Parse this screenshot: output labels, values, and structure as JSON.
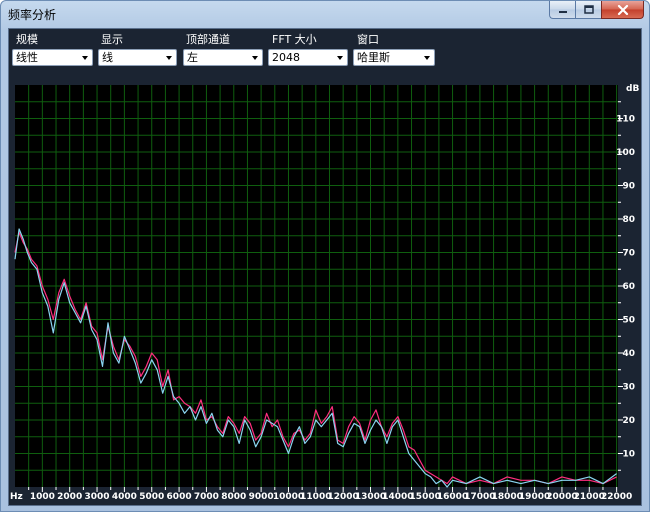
{
  "window": {
    "title": "频率分析",
    "minimize_icon": "minimize-icon",
    "maximize_icon": "maximize-icon",
    "close_icon": "close-icon"
  },
  "controls": [
    {
      "id": "scale",
      "label": "规模",
      "value": "线性"
    },
    {
      "id": "display",
      "label": "显示",
      "value": "线"
    },
    {
      "id": "top-channel",
      "label": "顶部通道",
      "value": "左"
    },
    {
      "id": "fft-size",
      "label": "FFT 大小",
      "value": "2048"
    },
    {
      "id": "window",
      "label": "窗口",
      "value": "哈里斯"
    }
  ],
  "colors": {
    "plot_background": "#000000",
    "grid": "#0f5e0f",
    "left_channel": "#ff2e7e",
    "right_channel": "#8ad4f0",
    "axis_text": "#ffffff"
  },
  "chart_data": {
    "type": "line",
    "x_unit": "Hz",
    "y_unit": "dB",
    "xlim": [
      0,
      22050
    ],
    "ylim": [
      0,
      120
    ],
    "x_ticks": [
      "1000",
      "2000",
      "3000",
      "4000",
      "5000",
      "6000",
      "7000",
      "8000",
      "9000",
      "10000",
      "11000",
      "12000",
      "13000",
      "14000",
      "15000",
      "16000",
      "17000",
      "18000",
      "19000",
      "20000",
      "21000",
      "22000"
    ],
    "y_ticks": [
      "10",
      "20",
      "30",
      "40",
      "50",
      "60",
      "70",
      "80",
      "90",
      "100",
      "110"
    ],
    "grid": true,
    "series": [
      {
        "color": "#ff2e7e",
        "x": [
          0,
          150,
          300,
          450,
          600,
          800,
          1000,
          1200,
          1400,
          1600,
          1800,
          2000,
          2200,
          2400,
          2600,
          2800,
          3000,
          3200,
          3400,
          3600,
          3800,
          4000,
          4200,
          4400,
          4600,
          4800,
          5000,
          5200,
          5400,
          5600,
          5800,
          6000,
          6200,
          6400,
          6600,
          6800,
          7000,
          7200,
          7400,
          7600,
          7800,
          8000,
          8200,
          8400,
          8600,
          8800,
          9000,
          9200,
          9400,
          9600,
          9800,
          10000,
          10200,
          10400,
          10600,
          10800,
          11000,
          11200,
          11400,
          11600,
          11800,
          12000,
          12200,
          12400,
          12600,
          12800,
          13000,
          13200,
          13400,
          13600,
          13800,
          14000,
          14200,
          14400,
          14600,
          14800,
          15000,
          15200,
          15400,
          15600,
          15800,
          16000,
          16500,
          17000,
          17500,
          18000,
          18500,
          19000,
          19500,
          20000,
          20500,
          21000,
          21500,
          22000
        ],
        "values": [
          70,
          76,
          73,
          71,
          68,
          66,
          60,
          56,
          50,
          58,
          62,
          57,
          53,
          50,
          55,
          48,
          46,
          38,
          48,
          42,
          38,
          44,
          42,
          39,
          33,
          36,
          40,
          38,
          30,
          35,
          26,
          27,
          25,
          24,
          22,
          26,
          20,
          21,
          18,
          16,
          21,
          19,
          16,
          21,
          19,
          14,
          16,
          22,
          18,
          20,
          15,
          12,
          16,
          17,
          14,
          16,
          23,
          19,
          21,
          24,
          14,
          13,
          18,
          21,
          19,
          14,
          20,
          23,
          18,
          15,
          19,
          21,
          17,
          12,
          11,
          8,
          5,
          4,
          3,
          2,
          1,
          3,
          1,
          2,
          1,
          3,
          2,
          2,
          1,
          3,
          2,
          2,
          1,
          3
        ]
      },
      {
        "color": "#8ad4f0",
        "x": [
          0,
          150,
          300,
          450,
          600,
          800,
          1000,
          1200,
          1400,
          1600,
          1800,
          2000,
          2200,
          2400,
          2600,
          2800,
          3000,
          3200,
          3400,
          3600,
          3800,
          4000,
          4200,
          4400,
          4600,
          4800,
          5000,
          5200,
          5400,
          5600,
          5800,
          6000,
          6200,
          6400,
          6600,
          6800,
          7000,
          7200,
          7400,
          7600,
          7800,
          8000,
          8200,
          8400,
          8600,
          8800,
          9000,
          9200,
          9400,
          9600,
          9800,
          10000,
          10200,
          10400,
          10600,
          10800,
          11000,
          11200,
          11400,
          11600,
          11800,
          12000,
          12200,
          12400,
          12600,
          12800,
          13000,
          13200,
          13400,
          13600,
          13800,
          14000,
          14200,
          14400,
          14600,
          14800,
          15000,
          15200,
          15400,
          15600,
          15800,
          16000,
          16500,
          17000,
          17500,
          18000,
          18500,
          19000,
          19500,
          20000,
          20500,
          21000,
          21500,
          22000
        ],
        "values": [
          68,
          77,
          74,
          70,
          67,
          65,
          58,
          54,
          46,
          56,
          61,
          55,
          52,
          49,
          54,
          47,
          44,
          36,
          49,
          40,
          37,
          45,
          41,
          37,
          31,
          34,
          38,
          35,
          28,
          33,
          27,
          25,
          22,
          24,
          20,
          24,
          19,
          22,
          17,
          15,
          20,
          18,
          13,
          20,
          17,
          12,
          15,
          20,
          19,
          18,
          14,
          10,
          15,
          18,
          13,
          15,
          20,
          18,
          20,
          22,
          13,
          12,
          16,
          19,
          18,
          13,
          17,
          20,
          18,
          13,
          18,
          20,
          15,
          10,
          8,
          6,
          4,
          3,
          1,
          2,
          0,
          2,
          1,
          3,
          1,
          2,
          1,
          2,
          1,
          2,
          2,
          3,
          1,
          4
        ]
      }
    ]
  }
}
